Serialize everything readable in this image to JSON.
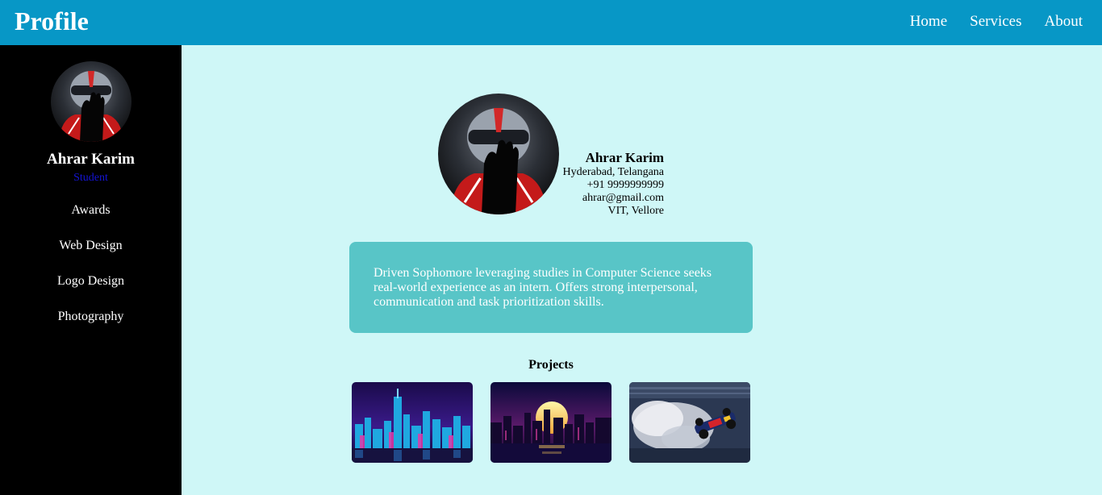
{
  "header": {
    "brand": "Profile",
    "nav": [
      "Home",
      "Services",
      "About"
    ],
    "bg_color": "#0797c6"
  },
  "sidebar": {
    "name": "Ahrar Karim",
    "role": "Student",
    "menu": [
      "Awards",
      "Web Design",
      "Logo Design",
      "Photography"
    ],
    "role_color": "#1414d6"
  },
  "profile": {
    "name": "Ahrar Karim",
    "location": "Hyderabad, Telangana",
    "phone": "+91 9999999999",
    "email": "ahrar@gmail.com",
    "college": "VIT, Vellore"
  },
  "summary": {
    "text": "Driven Sophomore leveraging studies in Computer Science seeks real-world experience as an intern. Offers strong interpersonal, communication and task prioritization skills.",
    "bg_color": "#58c5c7"
  },
  "projects": {
    "title": "Projects",
    "items": [
      "city-skyline-image",
      "sunset-city-image",
      "race-car-image"
    ]
  },
  "page": {
    "bg_color": "#cff7f7"
  }
}
